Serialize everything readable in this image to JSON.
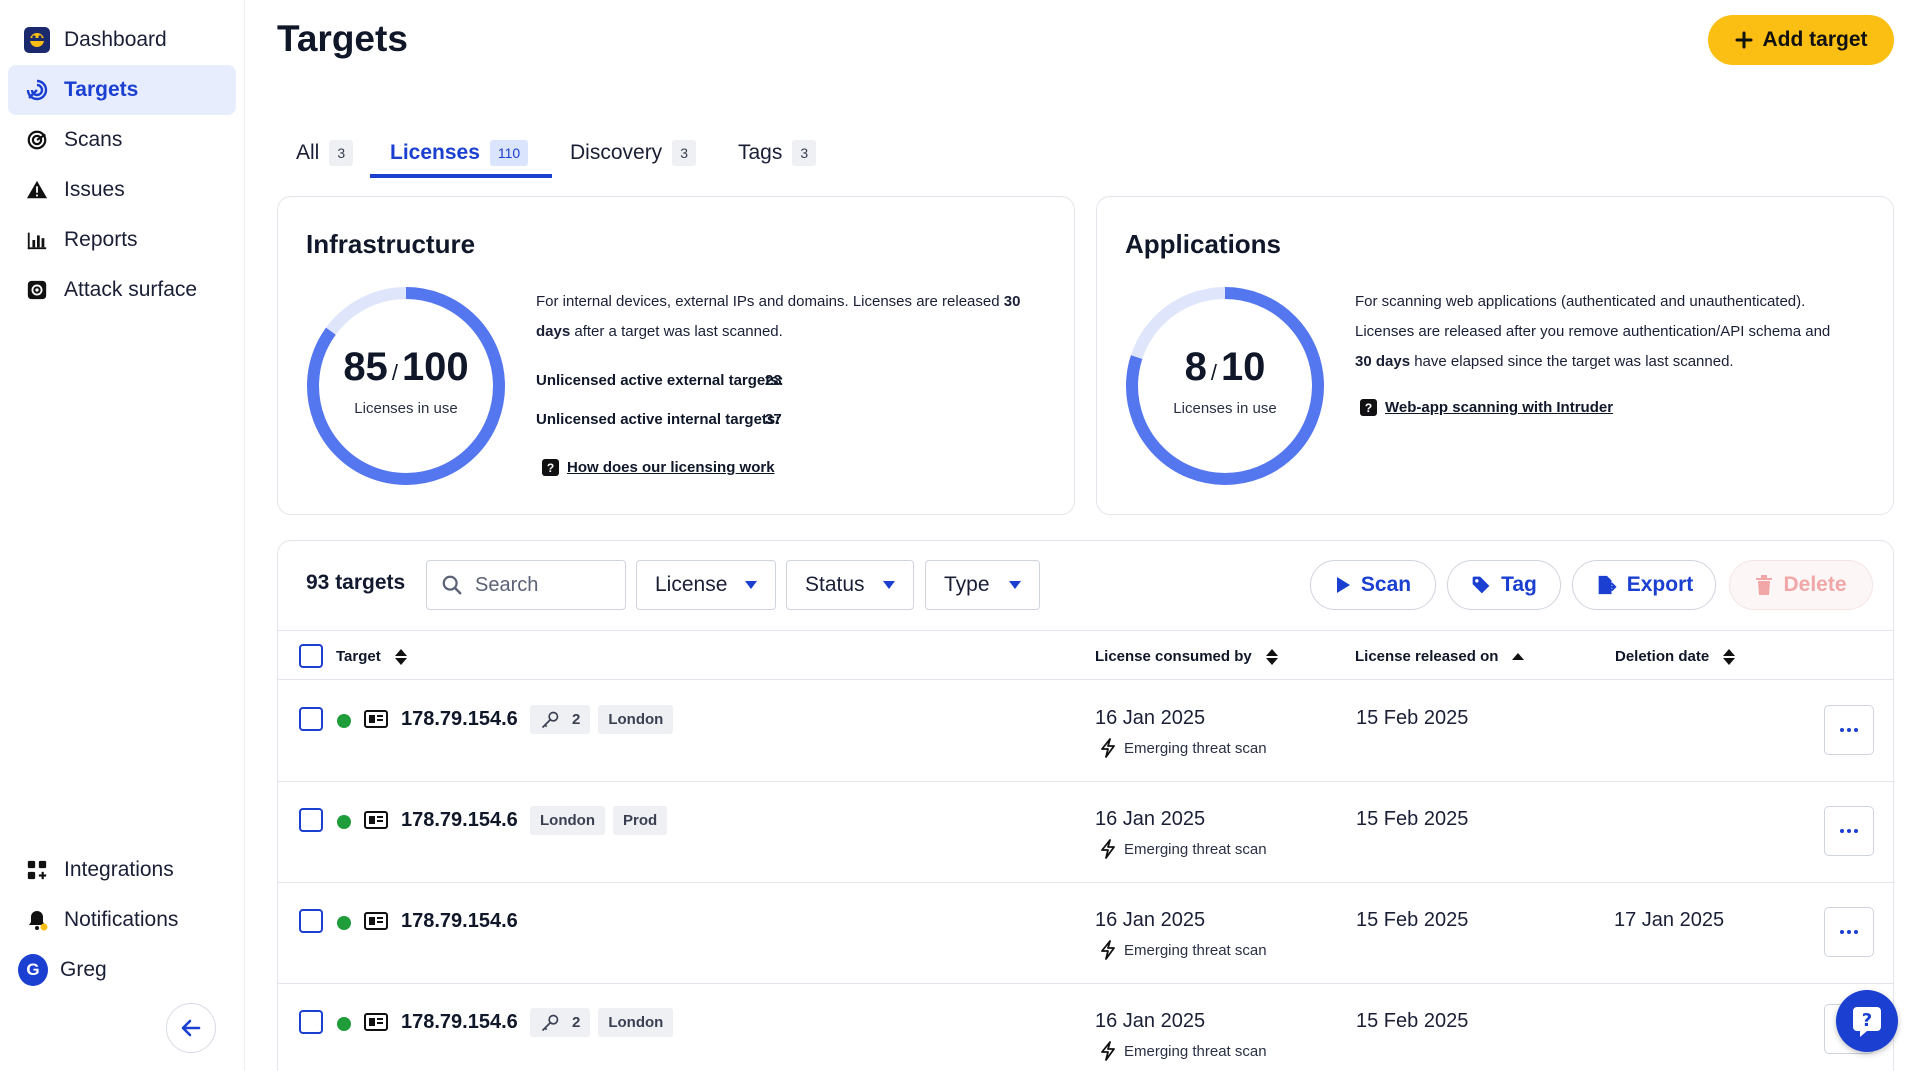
{
  "sidebar": {
    "items": [
      {
        "label": "Dashboard",
        "icon": "dashboard-logo-icon"
      },
      {
        "label": "Targets",
        "icon": "targets-icon",
        "active": true
      },
      {
        "label": "Scans",
        "icon": "scans-icon"
      },
      {
        "label": "Issues",
        "icon": "warning-icon"
      },
      {
        "label": "Reports",
        "icon": "bar-chart-icon"
      },
      {
        "label": "Attack surface",
        "icon": "attack-surface-icon"
      }
    ],
    "bottom": [
      {
        "label": "Integrations",
        "icon": "grid-plus-icon"
      },
      {
        "label": "Notifications",
        "icon": "bell-icon"
      },
      {
        "label": "Greg",
        "avatar": "G"
      }
    ]
  },
  "header": {
    "title": "Targets",
    "add_button": "Add target"
  },
  "tabs": [
    {
      "label": "All",
      "count": "3"
    },
    {
      "label": "Licenses",
      "count": "110",
      "active": true
    },
    {
      "label": "Discovery",
      "count": "3"
    },
    {
      "label": "Tags",
      "count": "3"
    }
  ],
  "infrastructure": {
    "title": "Infrastructure",
    "used": "85",
    "total": "100",
    "used_fraction": 0.85,
    "sub": "Licenses in use",
    "desc_a": "For internal devices, external IPs and domains. Licenses are released ",
    "desc_bold": "30",
    "desc_b_bold": "days",
    "desc_c": " after a target was last scanned.",
    "external_label": "Unlicensed active external targets:",
    "external_value": "23",
    "internal_label": "Unlicensed active internal targets:",
    "internal_value": "37",
    "link": "How does our licensing work"
  },
  "applications": {
    "title": "Applications",
    "used": "8",
    "total": "10",
    "used_fraction": 0.8,
    "sub": "Licenses in use",
    "desc_1": "For scanning web applications (authenticated and unauthenticated).",
    "desc_2": "Licenses are released after you remove authentication/API schema and",
    "desc_3_bold": "30 days",
    "desc_3": " have elapsed since the target was last scanned.",
    "link": "Web-app scanning with Intruder"
  },
  "toolbar": {
    "count": "93 targets",
    "search_placeholder": "Search",
    "filters": [
      "License",
      "Status",
      "Type"
    ],
    "scan": "Scan",
    "tag": "Tag",
    "export": "Export",
    "delete": "Delete"
  },
  "columns": {
    "target": "Target",
    "consumed": "License consumed by",
    "released": "License released on",
    "deletion": "Deletion date"
  },
  "rows": [
    {
      "ip": "178.79.154.6",
      "keys": "2",
      "tags": [
        "London"
      ],
      "consumed": "16 Jan 2025",
      "scan_type": "Emerging threat scan",
      "released": "15 Feb 2025",
      "deletion": ""
    },
    {
      "ip": "178.79.154.6",
      "keys": "",
      "tags": [
        "London",
        "Prod"
      ],
      "consumed": "16 Jan 2025",
      "scan_type": "Emerging threat scan",
      "released": "15 Feb 2025",
      "deletion": ""
    },
    {
      "ip": "178.79.154.6",
      "keys": "",
      "tags": [],
      "consumed": "16 Jan 2025",
      "scan_type": "Emerging threat scan",
      "released": "15 Feb 2025",
      "deletion": "17 Jan 2025"
    },
    {
      "ip": "178.79.154.6",
      "keys": "2",
      "tags": [
        "London"
      ],
      "consumed": "16 Jan 2025",
      "scan_type": "Emerging threat scan",
      "released": "15 Feb 2025",
      "deletion": ""
    }
  ],
  "colors": {
    "accent": "#1a3fd1",
    "donut": "#5476ee",
    "donut_track": "#dfe5fb",
    "add_button": "#fbbf13",
    "status_green": "#1f9d3a"
  }
}
